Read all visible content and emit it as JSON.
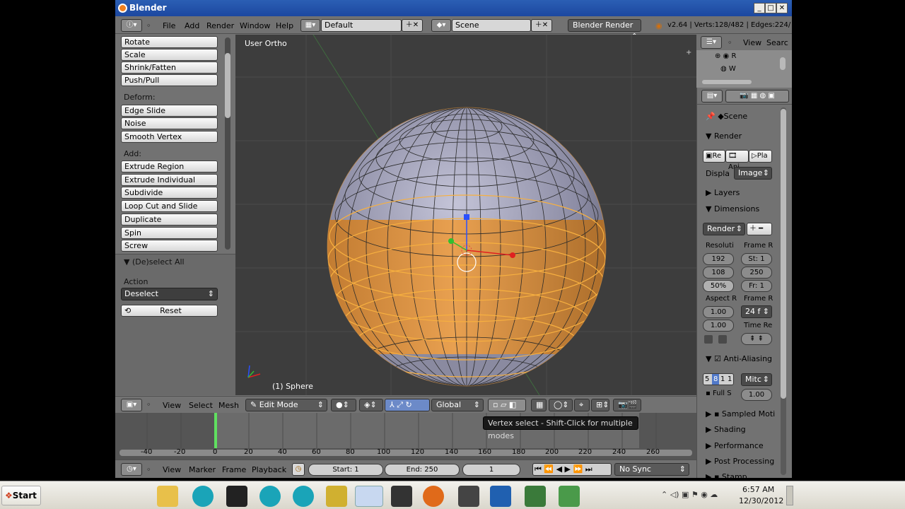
{
  "window": {
    "title": "Blender"
  },
  "topbar": {
    "menus": [
      "File",
      "Add",
      "Render",
      "Window",
      "Help"
    ],
    "layout": "Default",
    "scene": "Scene",
    "engine": "Blender Render",
    "stats": "v2.64 | Verts:128/482 | Edges:224/"
  },
  "toolshelf": {
    "transform_buttons": [
      "Rotate",
      "Scale",
      "Shrink/Fatten",
      "Push/Pull"
    ],
    "deform_label": "Deform:",
    "deform_buttons": [
      "Edge Slide",
      "Noise",
      "Smooth Vertex"
    ],
    "add_label": "Add:",
    "add_buttons": [
      "Extrude Region",
      "Extrude Individual",
      "Subdivide",
      "Loop Cut and Slide",
      "Duplicate",
      "Spin",
      "Screw"
    ],
    "operator_title": "(De)select All",
    "action_label": "Action",
    "action_value": "Deselect",
    "reset_label": "Reset"
  },
  "viewport": {
    "view_label": "User Ortho",
    "object_label": "(1) Sphere"
  },
  "viewport_header": {
    "menus": [
      "View",
      "Select",
      "Mesh"
    ],
    "mode": "Edit Mode",
    "orientation": "Global"
  },
  "tooltip": "Vertex select - Shift-Click for multiple modes",
  "timeline": {
    "ticks": [
      "-40",
      "-20",
      "0",
      "20",
      "40",
      "60",
      "80",
      "100",
      "120",
      "140",
      "160",
      "180",
      "200",
      "220",
      "240",
      "260"
    ],
    "current_frame_marker": "0"
  },
  "timeline_header": {
    "menus": [
      "View",
      "Marker",
      "Frame",
      "Playback"
    ],
    "start": "Start: 1",
    "end": "End: 250",
    "frame": "1",
    "sync": "No Sync"
  },
  "outliner": {
    "menus": [
      "View",
      "Searc"
    ],
    "items": [
      "R",
      "W"
    ]
  },
  "properties": {
    "context": "Scene",
    "render_panel": "Render",
    "render_buttons": [
      "Re",
      "Ani",
      "Pla"
    ],
    "display_label": "Displa",
    "display_value": "Image",
    "layers_panel": "Layers",
    "dimensions_panel": "Dimensions",
    "preset": "Render",
    "resolution_label": "Resoluti",
    "frame_range_label": "Frame R",
    "res_x": "192",
    "res_y": "108",
    "res_pct": "50%",
    "start_frame": "St: 1",
    "end_frame": "250",
    "frame_step": "Fr: 1",
    "aspect_label": "Aspect R",
    "frame_rate_label": "Frame R",
    "aspect_x": "1.00",
    "aspect_y": "1.00",
    "fps": "24 f",
    "time_remap_label": "Time Re",
    "aa_panel": "Anti-Aliasing",
    "aa_samples": [
      "5",
      "8",
      "1",
      "1"
    ],
    "aa_filter": "Mitc",
    "full_sample": "Full S",
    "aa_size": "1.00",
    "more_panels": [
      "Sampled Moti",
      "Shading",
      "Performance",
      "Post Processing",
      "Stamp"
    ]
  },
  "taskbar": {
    "start_label": "Start",
    "time": "6:57 AM",
    "date": "12/30/2012"
  },
  "colors": {
    "selected_orange": "#f5a040",
    "viewport_bg": "#3d3d3d",
    "panel_bg": "#727272"
  }
}
